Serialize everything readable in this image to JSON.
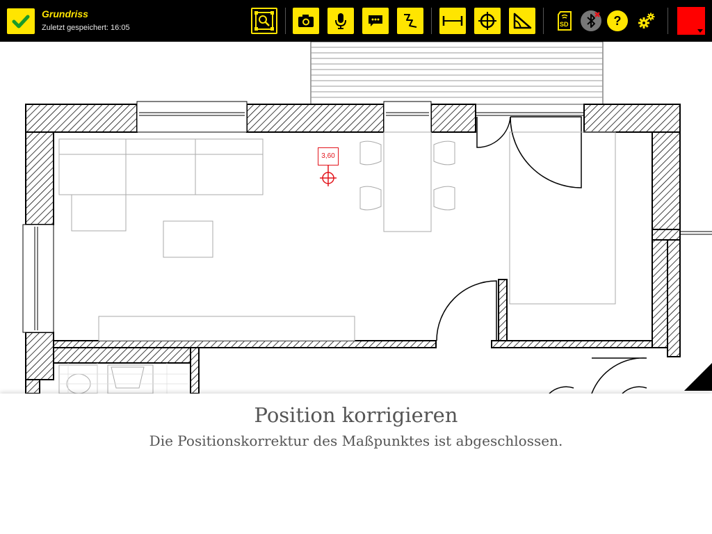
{
  "header": {
    "title": "Grundriss",
    "subtitle": "Zuletzt gespeichert: 16:05"
  },
  "toolbar": {
    "items": [
      {
        "name": "zoom-fit",
        "icon": "zoom-frame-icon"
      },
      {
        "name": "photo",
        "icon": "camera-icon"
      },
      {
        "name": "voice",
        "icon": "microphone-icon"
      },
      {
        "name": "comment",
        "icon": "speech-bubble-icon"
      },
      {
        "name": "freehand",
        "icon": "squiggle-icon"
      },
      {
        "name": "measure-distance",
        "icon": "ruler-icon"
      },
      {
        "name": "measure-point",
        "icon": "crosshair-icon"
      },
      {
        "name": "measure-angle",
        "icon": "angle-icon"
      },
      {
        "name": "sd-card",
        "icon": "sd-card-icon"
      },
      {
        "name": "bluetooth",
        "icon": "bluetooth-disconnected-icon"
      },
      {
        "name": "help",
        "icon": "question-icon"
      },
      {
        "name": "settings",
        "icon": "gears-icon"
      }
    ],
    "help_label": "?",
    "sd_label": "SD",
    "active_color": "#ff0000",
    "accent_color": "#ffe500"
  },
  "plan": {
    "measure_point_value": "3,60",
    "marker_color": "#e2141b"
  },
  "message": {
    "title": "Position korrigieren",
    "body": "Die Positionskorrektur des Maßpunktes ist abgeschlossen."
  }
}
